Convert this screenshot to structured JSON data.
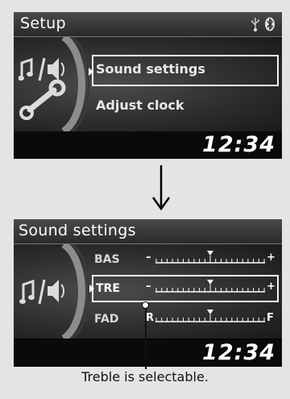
{
  "screen1": {
    "title": "Setup",
    "status_icons": [
      "usb-icon",
      "bluetooth-icon"
    ],
    "menu": {
      "selected": "Sound settings",
      "next": "Adjust clock"
    },
    "clock": "12:34"
  },
  "screen2": {
    "title": "Sound settings",
    "sliders": [
      {
        "label": "BAS",
        "left": "–",
        "right": "+",
        "level": 0.5
      },
      {
        "label": "TRE",
        "left": "–",
        "right": "+",
        "level": 0.5
      },
      {
        "label": "FAD",
        "left": "R",
        "right": "F",
        "level": 0.5
      }
    ],
    "clock": "12:34"
  },
  "caption": "Treble is selectable."
}
